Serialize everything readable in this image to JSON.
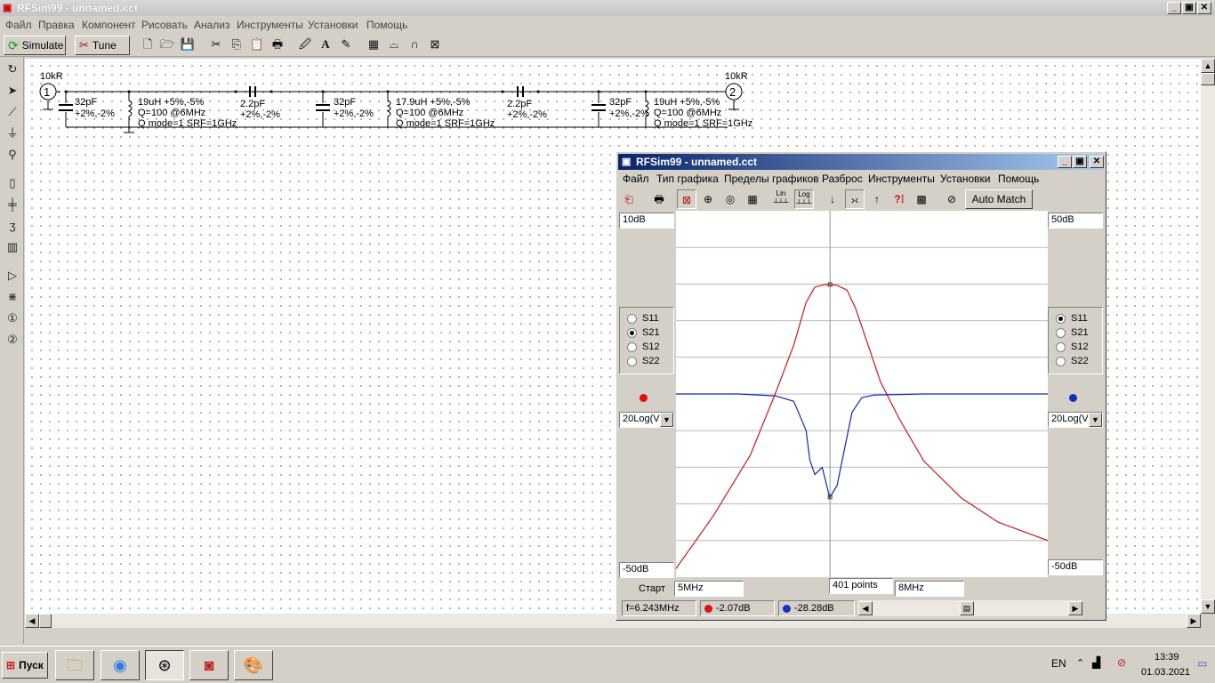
{
  "window": {
    "title": "RFSim99 - unnamed.cct",
    "minimize": "_",
    "restore": "▣",
    "close": "✕"
  },
  "menu": [
    "Файл",
    "Правка",
    "Компонент",
    "Рисовать",
    "Анализ",
    "Инструменты",
    "Установки",
    "Помощь"
  ],
  "toolbar": {
    "simulate": "Simulate",
    "tune": "Tune"
  },
  "schematic": {
    "port1": {
      "number": "1",
      "impedance": "10kR"
    },
    "port2": {
      "number": "2",
      "impedance": "10kR"
    },
    "components": [
      {
        "line1": "32pF",
        "line2": "+2%,-2%"
      },
      {
        "line1": "19uH  +5%,-5%",
        "line2": "Q=100 @6MHz",
        "line3": "Q mode=1 SRF=1GHz"
      },
      {
        "line1": "2.2pF",
        "line2": "+2%,-2%"
      },
      {
        "line1": "32pF",
        "line2": "+2%,-2%"
      },
      {
        "line1": "17.9uH  +5%,-5%",
        "line2": "Q=100 @6MHz",
        "line3": "Q mode=1 SRF=1GHz"
      },
      {
        "line1": "2.2pF",
        "line2": "+2%,-2%"
      },
      {
        "line1": "32pF",
        "line2": "+2%,-2%"
      },
      {
        "line1": "19uH  +5%,-5%",
        "line2": "Q=100 @6MHz",
        "line3": "Q mode=1 SRF=1GHz"
      }
    ]
  },
  "graph": {
    "title": "RFSim99 - unnamed.cct",
    "menu": [
      "Файл",
      "Тип графика",
      "Пределы графиков",
      "Разброс",
      "Инструменты",
      "Установки",
      "Помощь"
    ],
    "auto_match": "Auto Match",
    "left_axis": {
      "top": "10dB",
      "bottom": "-50dB",
      "scale": "20Log(V)",
      "selected": "S21",
      "marker_color": "#e01010"
    },
    "right_axis": {
      "top": "50dB",
      "bottom": "-50dB",
      "scale": "20Log(V)",
      "selected": "S11",
      "marker_color": "#1030c0"
    },
    "params": [
      "S11",
      "S21",
      "S12",
      "S22"
    ],
    "start_label": "Старт",
    "start": "5MHz",
    "points": "401 points",
    "stop": "8MHz",
    "status": {
      "freq": "f=6.243MHz",
      "s21": "-2.07dB",
      "s11": "-28.28dB"
    },
    "lin_label": "Lin",
    "log_label": "Log"
  },
  "chart_data": {
    "type": "line",
    "x_unit": "MHz",
    "xlim": [
      5,
      8
    ],
    "series": [
      {
        "name": "S21",
        "axis": "left",
        "color": "#c81818",
        "ylim": [
          -50,
          10
        ],
        "x": [
          5.0,
          5.3,
          5.6,
          5.8,
          5.95,
          6.05,
          6.12,
          6.2,
          6.24,
          6.3,
          6.38,
          6.45,
          6.55,
          6.65,
          6.8,
          7.0,
          7.3,
          7.6,
          8.0
        ],
        "y": [
          -48.6,
          -40,
          -30,
          -20,
          -12,
          -5,
          -2.5,
          -2.1,
          -2.07,
          -2.2,
          -3,
          -6,
          -12,
          -18,
          -24,
          -31,
          -37,
          -41,
          -44
        ]
      },
      {
        "name": "S11",
        "axis": "right",
        "color": "#1028b0",
        "ylim": [
          -50,
          50
        ],
        "x": [
          5.0,
          5.5,
          5.8,
          5.95,
          6.05,
          6.08,
          6.12,
          6.18,
          6.24,
          6.3,
          6.36,
          6.42,
          6.5,
          6.6,
          7.0,
          8.0
        ],
        "y": [
          0,
          0,
          -0.5,
          -2,
          -10,
          -18,
          -22,
          -20,
          -28.28,
          -25,
          -15,
          -5,
          -1,
          -0.3,
          0,
          0
        ]
      }
    ]
  },
  "taskbar": {
    "start": "Пуск",
    "lang": "EN",
    "time": "13:39",
    "date": "01.03.2021"
  }
}
